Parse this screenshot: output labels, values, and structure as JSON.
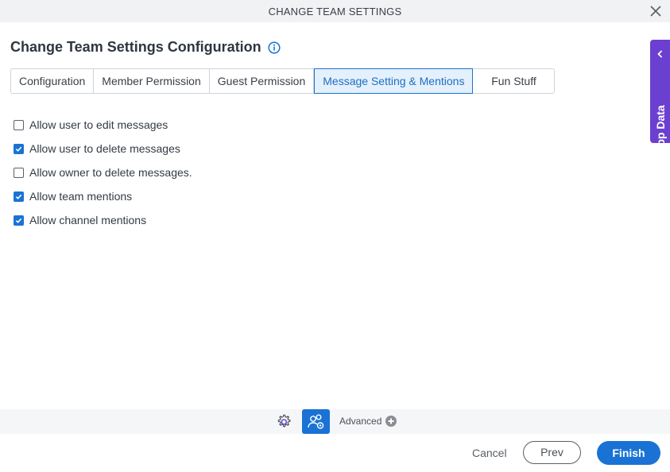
{
  "window": {
    "title": "CHANGE TEAM SETTINGS",
    "close_icon": "close-icon"
  },
  "heading": {
    "text": "Change Team Settings Configuration",
    "info_icon": "info-icon"
  },
  "tabs": [
    {
      "label": "Configuration",
      "active": false
    },
    {
      "label": "Member Permission",
      "active": false
    },
    {
      "label": "Guest Permission",
      "active": false
    },
    {
      "label": "Message Setting & Mentions",
      "active": true
    },
    {
      "label": "Fun Stuff",
      "active": false
    }
  ],
  "options": [
    {
      "label": "Allow user to edit messages",
      "checked": false
    },
    {
      "label": "Allow user to delete messages",
      "checked": true
    },
    {
      "label": "Allow owner to delete messages.",
      "checked": false
    },
    {
      "label": "Allow team mentions",
      "checked": true
    },
    {
      "label": "Allow channel mentions",
      "checked": true
    }
  ],
  "side_panel": {
    "label": "App Data",
    "icon": "chevron-left-icon",
    "color": "#6b3fd0"
  },
  "toolbar": {
    "advanced_label": "Advanced",
    "icons": [
      "gear-icon",
      "team-settings-icon",
      "plus-circle-icon"
    ]
  },
  "footer": {
    "cancel_label": "Cancel",
    "prev_label": "Prev",
    "finish_label": "Finish"
  },
  "colors": {
    "accent": "#1a73d4",
    "app_data": "#6b3fd0"
  }
}
